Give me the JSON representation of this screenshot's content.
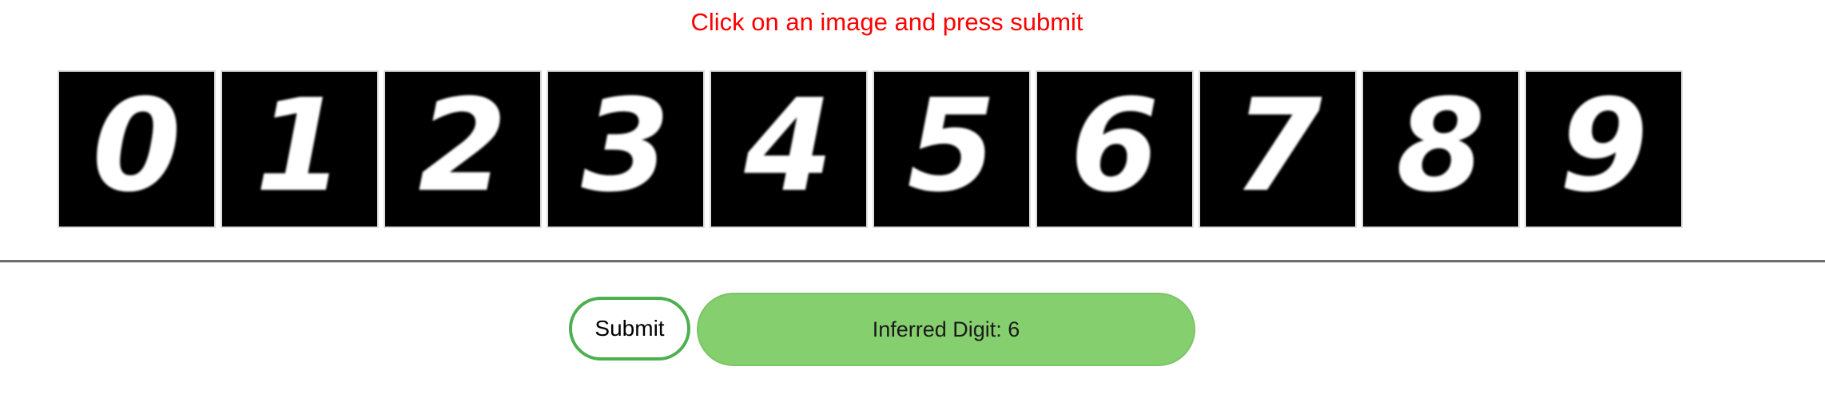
{
  "instruction": "Click on an image and press submit",
  "digits": [
    {
      "label": "0"
    },
    {
      "label": "1"
    },
    {
      "label": "2"
    },
    {
      "label": "3"
    },
    {
      "label": "4"
    },
    {
      "label": "5"
    },
    {
      "label": "6"
    },
    {
      "label": "7"
    },
    {
      "label": "8"
    },
    {
      "label": "9"
    }
  ],
  "submit_label": "Submit",
  "result_text": "Inferred Digit: 6",
  "colors": {
    "instruction": "#ff0000",
    "submit_border": "#4caf50",
    "result_background": "#85cf6e",
    "tile_background": "#000000",
    "tile_border": "#dcdcdc"
  }
}
